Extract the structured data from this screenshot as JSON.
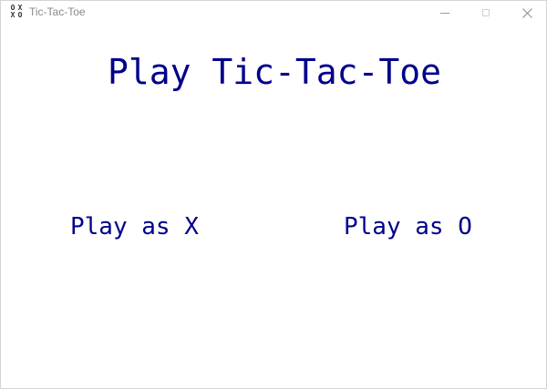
{
  "window": {
    "title": "Tic-Tac-Toe",
    "icon_name": "tic-tac-toe-icon",
    "icon_glyphs": [
      "O",
      "X",
      "X",
      "O"
    ],
    "minimize_icon": "minimize-icon",
    "maximize_icon": "maximize-icon",
    "close_icon": "close-icon"
  },
  "main": {
    "heading": "Play Tic-Tac-Toe",
    "play_x_label": "Play as X",
    "play_o_label": "Play as O"
  },
  "colors": {
    "text_accent": "#00008b",
    "background": "#ffffff",
    "titlebar_text": "#8a8a8a"
  }
}
